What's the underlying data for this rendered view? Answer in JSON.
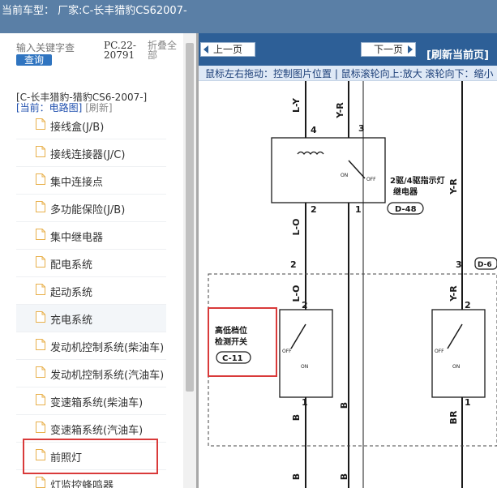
{
  "header": {
    "title": "当前车型： 厂家:C-长丰猎豹CS62007-"
  },
  "sidebar": {
    "search_placeholder": "输入关键字查",
    "query_button": "查询",
    "pc_code": "PC.22-20791",
    "fold_all": "折叠全部",
    "car_path": "[C-长丰猎豹-猎豹CS6-2007-]",
    "current_label": "[当前：电路图]",
    "refresh_label": "[刷新]",
    "items": [
      {
        "label": "接线盒(J/B)"
      },
      {
        "label": "接线连接器(J/C)"
      },
      {
        "label": "集中连接点"
      },
      {
        "label": "多功能保险(J/B)"
      },
      {
        "label": "集中继电器"
      },
      {
        "label": "配电系统"
      },
      {
        "label": "起动系统"
      },
      {
        "label": "充电系统"
      },
      {
        "label": "发动机控制系统(柴油车)"
      },
      {
        "label": "发动机控制系统(汽油车)"
      },
      {
        "label": "变速箱系统(柴油车)"
      },
      {
        "label": "变速箱系统(汽油车)"
      },
      {
        "label": "前照灯"
      },
      {
        "label": "灯监控蜂鸣器"
      }
    ]
  },
  "viewer": {
    "prev_button": "上一页",
    "next_button": "下一页",
    "refresh_page": "[刷新当前页]",
    "hint": "鼠标左右拖动：控制图片位置 | 鼠标滚轮向上:放大  滚轮向下：缩小"
  },
  "diagram": {
    "wire_ly": "L-Y",
    "wire_yr_top": "Y-R",
    "wire_yr_right": "Y-R",
    "wire_lo_1": "L-O",
    "wire_lo_2": "L-O",
    "wire_yr_mid": "Y-R",
    "wire_b_1": "B",
    "wire_b_2": "B",
    "wire_b_3": "B",
    "wire_b_4": "B",
    "wire_br": "BR",
    "pin_4": "4",
    "pin_3": "3",
    "pin_2a": "2",
    "pin_1a": "1",
    "pin_2b": "2",
    "pin_3b": "3",
    "pin_2c": "2",
    "pin_1b": "1",
    "pin_2d": "2",
    "pin_1c": "1",
    "relay_name_1": "2驱/4驱指示灯",
    "relay_name_2": "继电器",
    "relay_code": "D-48",
    "relay_on": "ON",
    "relay_off": "OFF",
    "switch_name_1": "高低档位",
    "switch_name_2": "检测开关",
    "switch_code": "C-11",
    "switch_off": "OFF",
    "switch_on": "ON",
    "switch2_off": "OFF",
    "switch2_on": "ON",
    "right_code": "D-6"
  },
  "colors": {
    "topbar": "#5a7fa6",
    "navbar": "#2d5f97",
    "highlight": "#d93a3a",
    "link": "#1f4fae"
  }
}
